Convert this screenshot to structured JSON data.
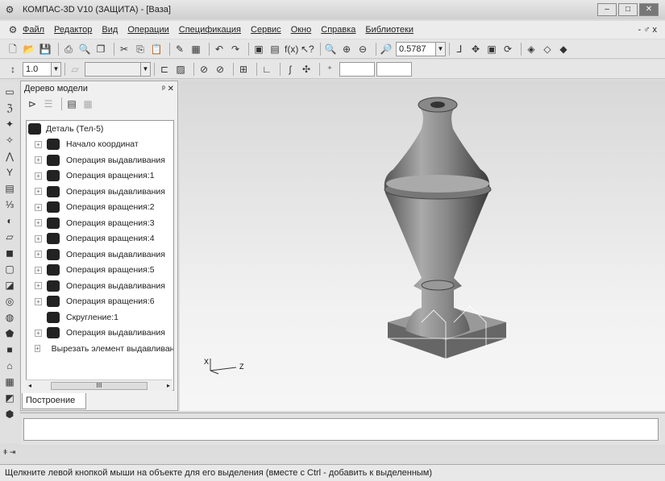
{
  "window": {
    "title": "КОМПАС-3D V10 (ЗАЩИТА) - [Ваза]",
    "min": "–",
    "max": "□",
    "close": "✕"
  },
  "menu": [
    "Файл",
    "Редактор",
    "Вид",
    "Операции",
    "Спецификация",
    "Сервис",
    "Окно",
    "Справка",
    "Библиотеки"
  ],
  "menu_right": "- ♂ x",
  "toolbar": {
    "zoom_value": "0.5787",
    "step_value": "1.0"
  },
  "tree": {
    "title": "Дерево модели",
    "pin": "ᵖ ✕",
    "root": "Деталь (Тел-5)",
    "items": [
      "Начало координат",
      "Операция выдавливания",
      "Операция вращения:1",
      "Операция выдавливания",
      "Операция вращения:2",
      "Операция вращения:3",
      "Операция вращения:4",
      "Операция выдавливания",
      "Операция вращения:5",
      "Операция выдавливания",
      "Операция вращения:6",
      "Скругление:1",
      "Операция выдавливания",
      "Вырезать элемент выдавливания"
    ],
    "scroll_thumb": "III",
    "tab": "Построение"
  },
  "axes": {
    "x": "X",
    "z": "Z"
  },
  "status": "Щелкните левой кнопкой мыши на объекте для его выделения (вместе с Ctrl - добавить к выделенным)"
}
